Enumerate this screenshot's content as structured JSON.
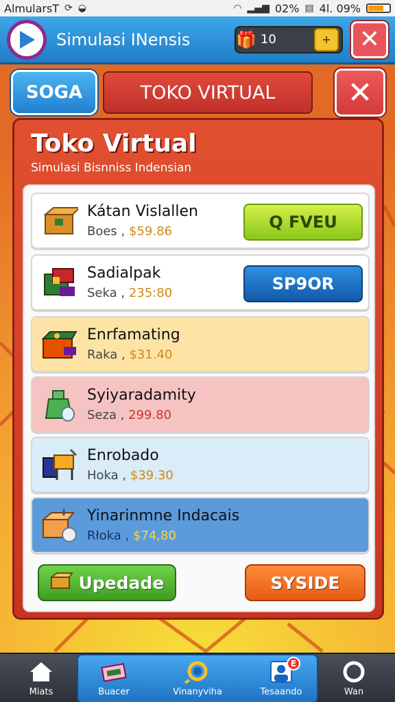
{
  "status_bar": {
    "carrier": "AlmularsT",
    "signal_text": "02%",
    "battery_text": "4l. 09%"
  },
  "app_bar": {
    "title": "Simulasi INensis",
    "coins": "10"
  },
  "header": {
    "left_tab": "SOGA",
    "center_tab": "TOKO VIRTUAL",
    "close_label": "✕"
  },
  "panel": {
    "title": "Toko Virtual",
    "subtitle": "Simulasi Bisnniss Indensian"
  },
  "items": [
    {
      "name": "Kátan Vislallen",
      "prefix": "Boes ,",
      "price": "$59.86",
      "bg": "#ffffff",
      "price_style": "gold",
      "button": "Q FVEU",
      "button_style": "green"
    },
    {
      "name": "Sadialpak",
      "prefix": "Seka ,",
      "price": "235:80",
      "bg": "#ffffff",
      "price_style": "gold",
      "button": "SP9OR",
      "button_style": "blue"
    },
    {
      "name": "Enrfamating",
      "prefix": "Raka ,",
      "price": "$31.40",
      "bg": "#fde3a6",
      "price_style": "gold",
      "button": "",
      "button_style": ""
    },
    {
      "name": "Syiyaradamity",
      "prefix": "Seza ,",
      "price": "299.80",
      "bg": "#f6c3c3",
      "price_style": "red",
      "button": "",
      "button_style": ""
    },
    {
      "name": "Enrobado",
      "prefix": "Hoka ,",
      "price": "$39.30",
      "bg": "#d9ecf8",
      "price_style": "gold",
      "button": "",
      "button_style": ""
    },
    {
      "name": "Yinarinmne Indacais",
      "prefix": "Rłoka ,",
      "price": "$74,80",
      "bg": "#5b9bdc",
      "price_style": "yellow",
      "button": "",
      "button_style": ""
    }
  ],
  "bottom_buttons": {
    "left": "Upedade",
    "right": "SYSIDE"
  },
  "nav": [
    {
      "label": "Miats",
      "icon": "home-icon"
    },
    {
      "label": "Buacer",
      "icon": "cart-icon"
    },
    {
      "label": "Vinanyviha",
      "icon": "search-icon"
    },
    {
      "label": "Tesaando",
      "icon": "profile-icon",
      "badge": "E"
    },
    {
      "label": "Wan",
      "icon": "circle-icon"
    }
  ]
}
